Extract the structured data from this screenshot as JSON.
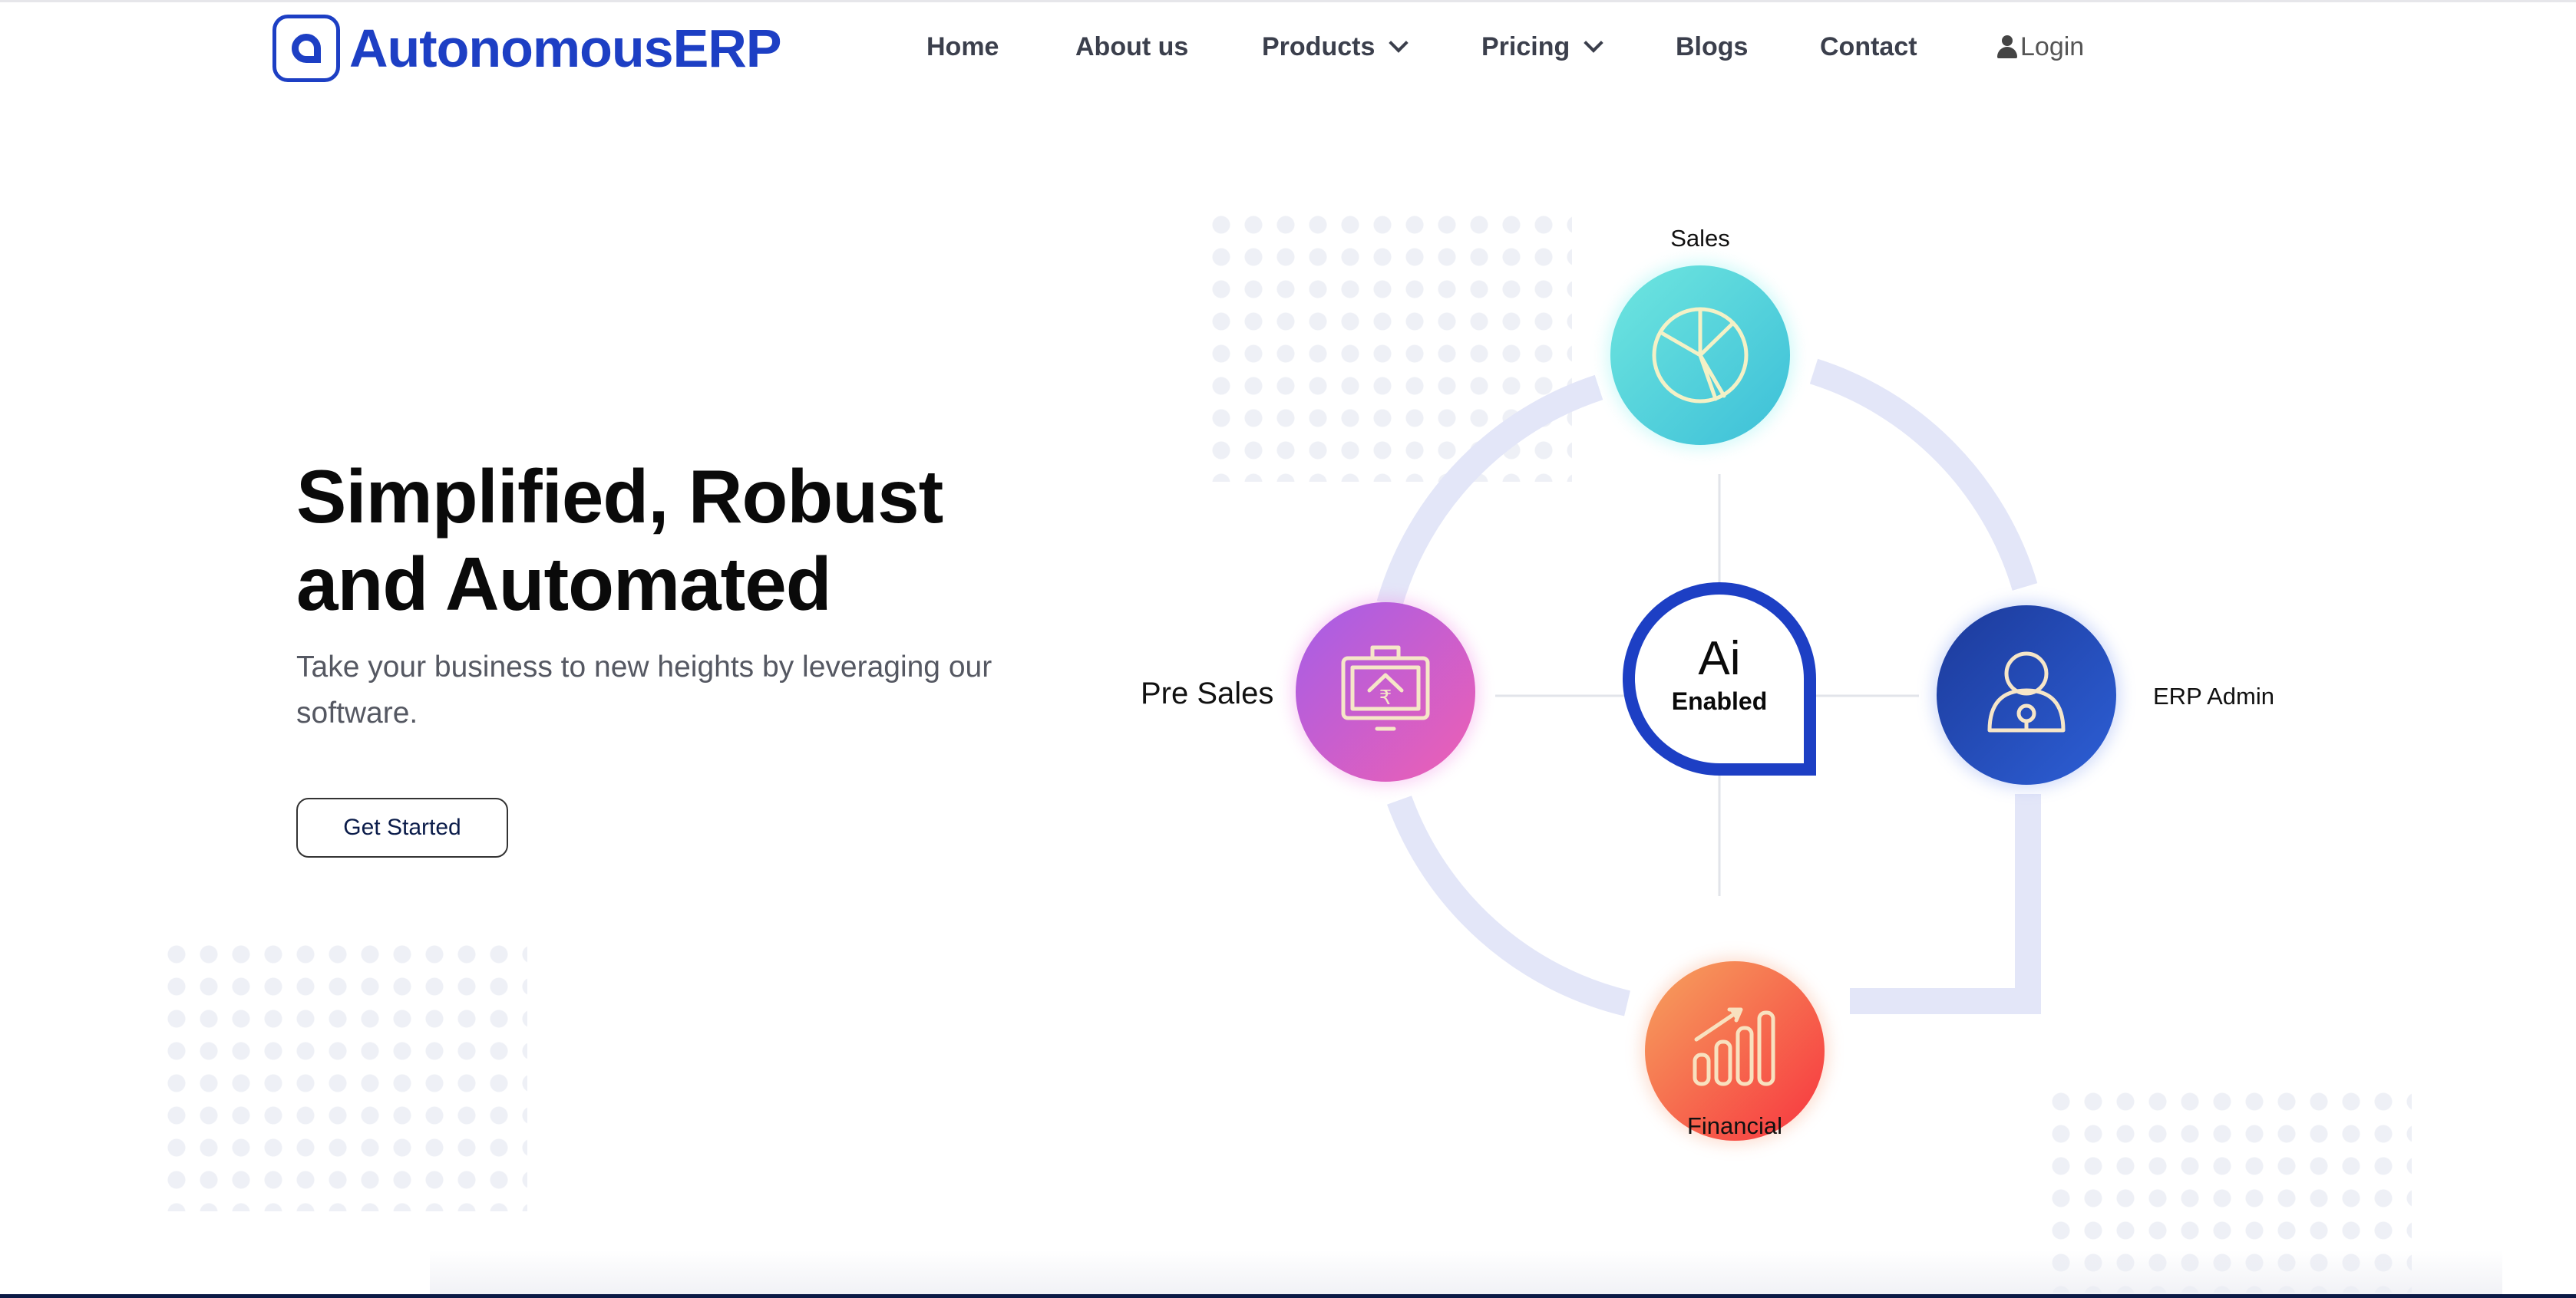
{
  "brand": {
    "name": "AutonomousERP",
    "color": "#1d3fc4"
  },
  "nav": {
    "home": "Home",
    "about": "About us",
    "products": "Products",
    "pricing": "Pricing",
    "blogs": "Blogs",
    "contact": "Contact",
    "login": "Login"
  },
  "hero": {
    "title_line1": "Simplified, Robust",
    "title_line2": "and Automated",
    "subtitle": "Take your business to new heights by leveraging our software.",
    "cta": "Get Started"
  },
  "diagram": {
    "center_line1": "Ai",
    "center_line2": "Enabled",
    "nodes": {
      "sales": {
        "label": "Sales",
        "icon": "pie-chart-icon",
        "color": "#4fd3d8"
      },
      "pre_sales": {
        "label": "Pre Sales",
        "icon": "rupee-briefcase-icon",
        "color": "#c45fd6"
      },
      "erp_admin": {
        "label": "ERP Admin",
        "icon": "user-lock-icon",
        "color": "#2247b8"
      },
      "financial": {
        "label": "Financial",
        "icon": "growth-chart-icon",
        "color": "#f6533d"
      }
    }
  }
}
